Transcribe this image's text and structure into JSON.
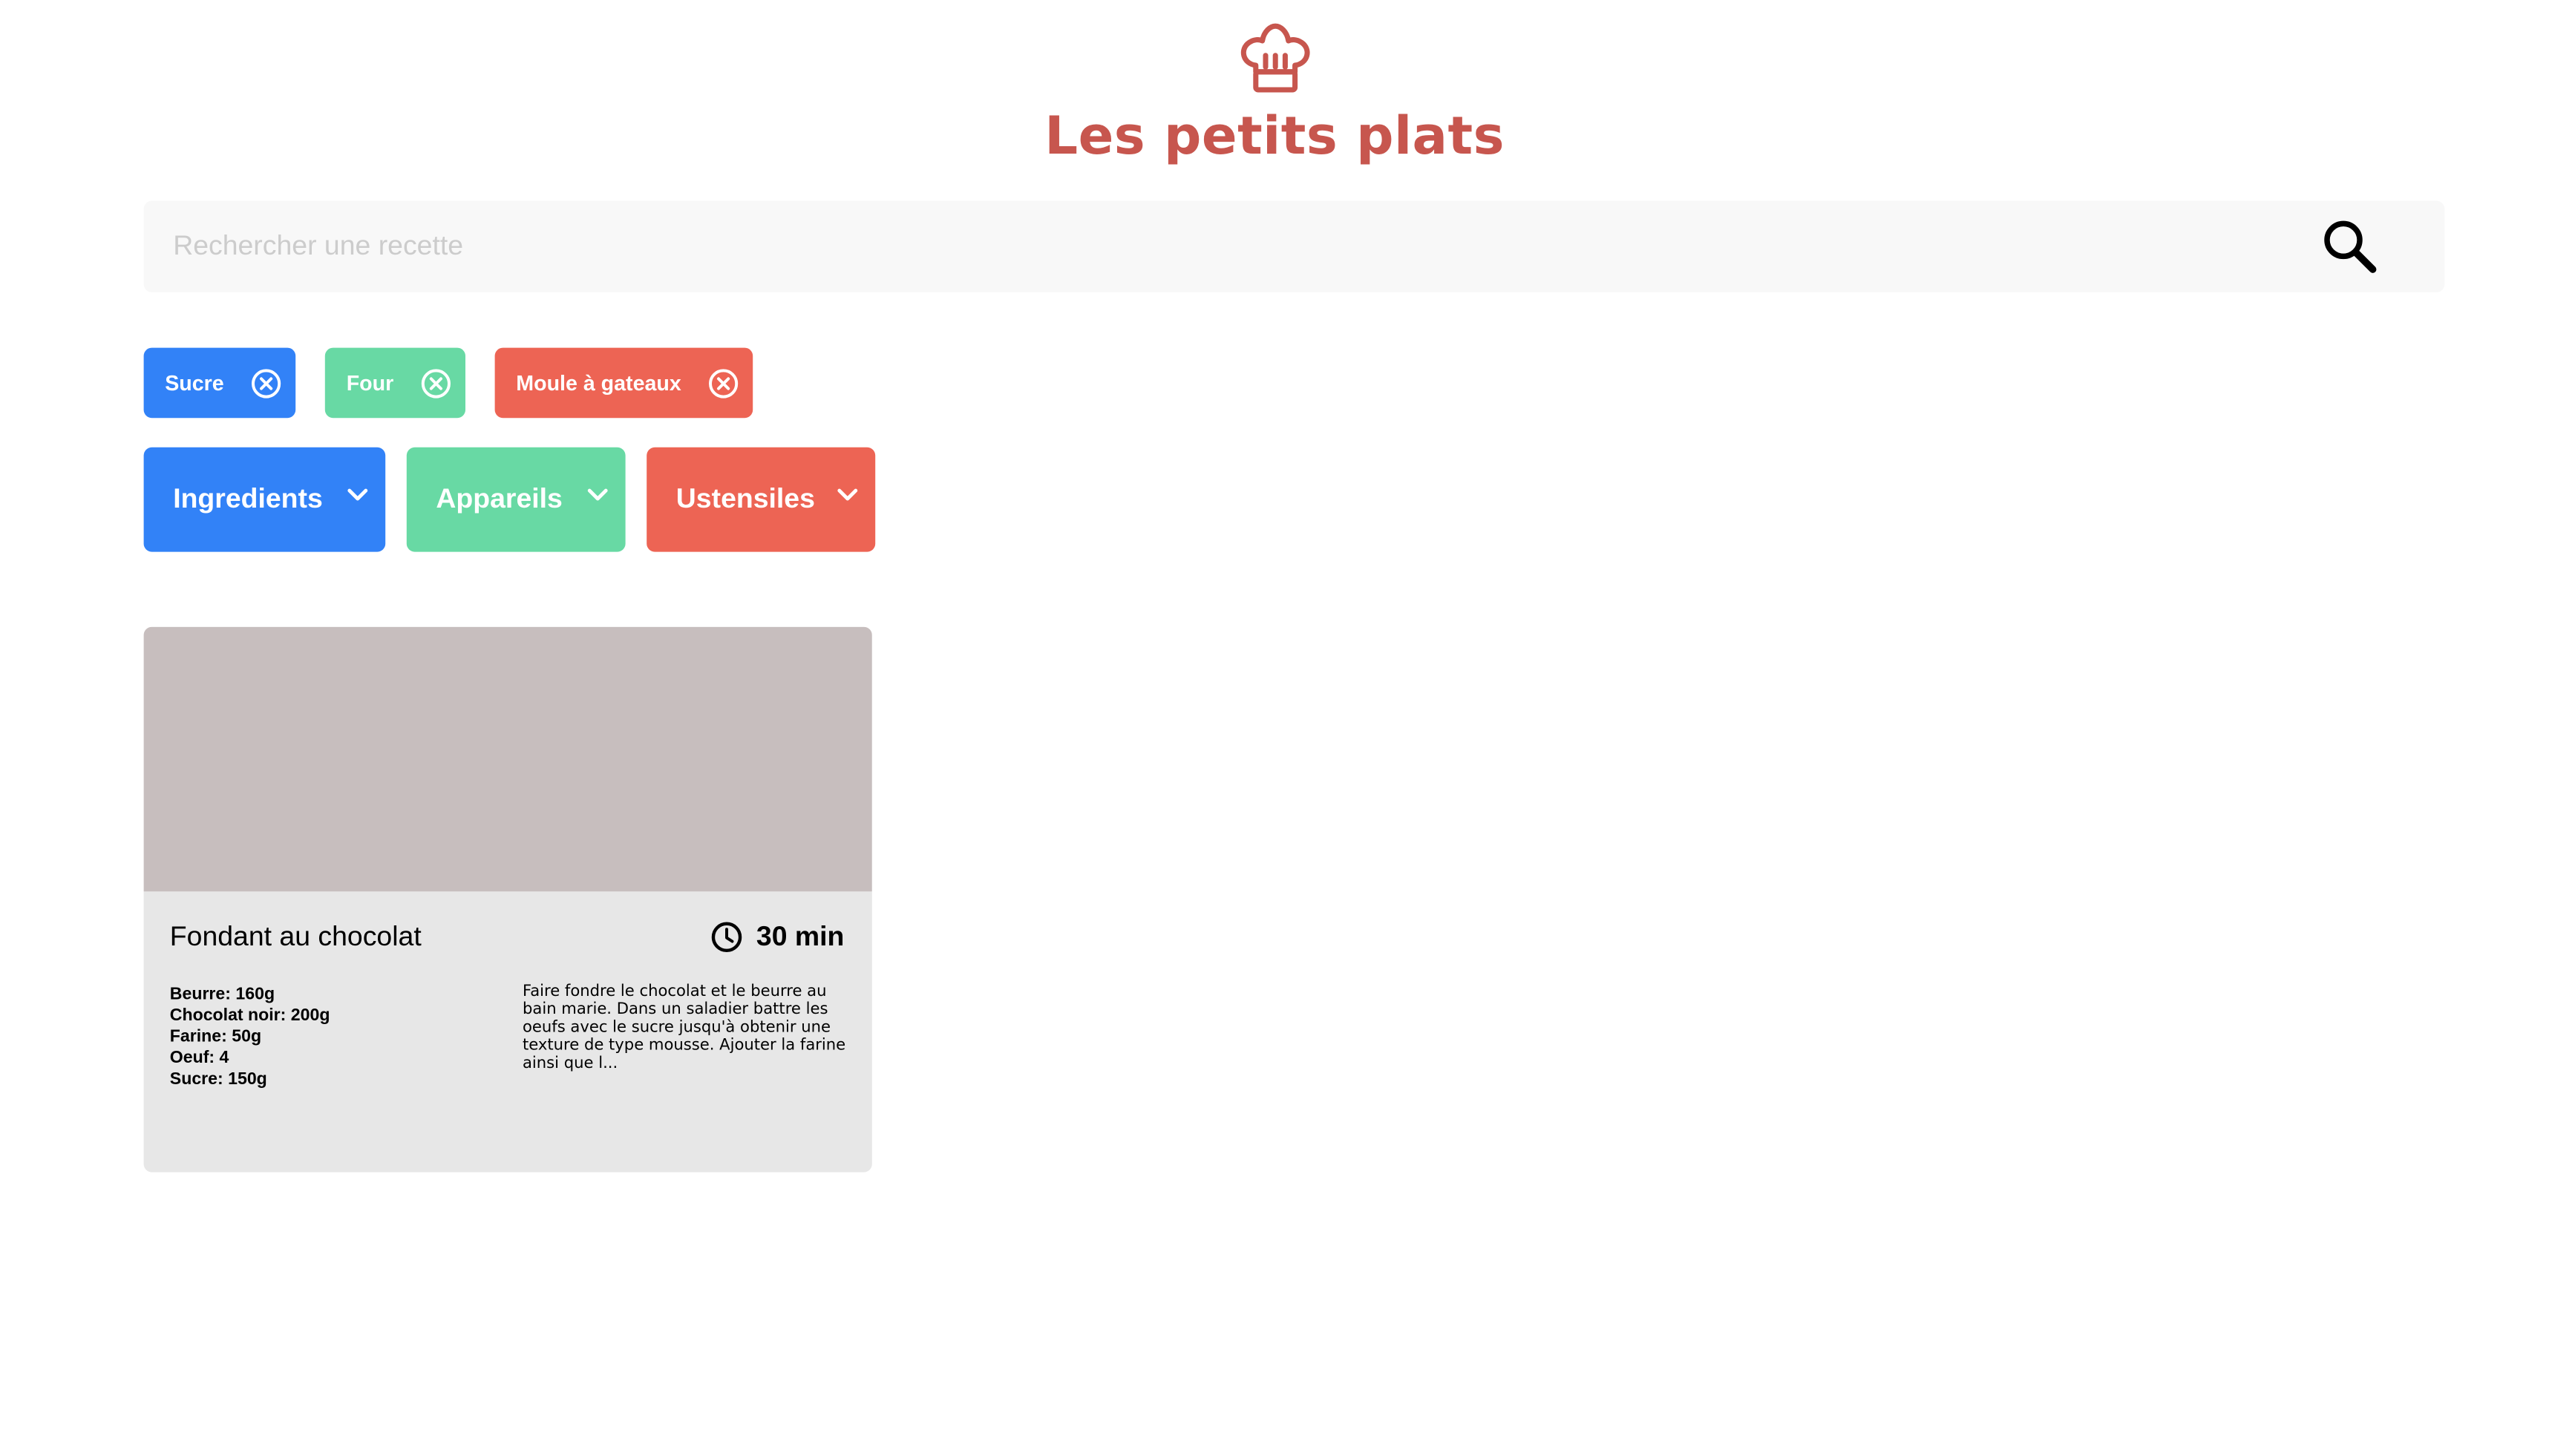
{
  "header": {
    "logo_icon": "chef-hat-icon",
    "title": "Les petits plats",
    "brand_color": "#C7564E"
  },
  "search": {
    "placeholder": "Rechercher une recette",
    "value": "",
    "icon": "search-icon"
  },
  "selected_tags": [
    {
      "label": "Sucre",
      "color": "#3282F7",
      "category": "ingredients"
    },
    {
      "label": "Four",
      "color": "#68D9A4",
      "category": "appareils"
    },
    {
      "label": "Moule à gateaux",
      "color": "#ED6454",
      "category": "ustensiles"
    }
  ],
  "filters": [
    {
      "label": "Ingredients",
      "color": "#3282F7",
      "icon": "chevron-down-icon"
    },
    {
      "label": "Appareils",
      "color": "#68D9A4",
      "icon": "chevron-down-icon"
    },
    {
      "label": "Ustensiles",
      "color": "#ED6454",
      "icon": "chevron-down-icon"
    }
  ],
  "recipes": [
    {
      "title": "Fondant au chocolat",
      "time": "30 min",
      "time_icon": "clock-icon",
      "ingredients": [
        {
          "name": "Beurre",
          "quantity": "160g"
        },
        {
          "name": "Chocolat noir",
          "quantity": "200g"
        },
        {
          "name": "Farine",
          "quantity": "50g"
        },
        {
          "name": "Oeuf",
          "quantity": "4"
        },
        {
          "name": "Sucre",
          "quantity": "150g"
        }
      ],
      "description": "Faire fondre le chocolat et le beurre au bain marie. Dans un saladier battre les oeufs avec le sucre jusqu'à obtenir une texture de type mousse. Ajouter la farine ainsi que l..."
    }
  ]
}
